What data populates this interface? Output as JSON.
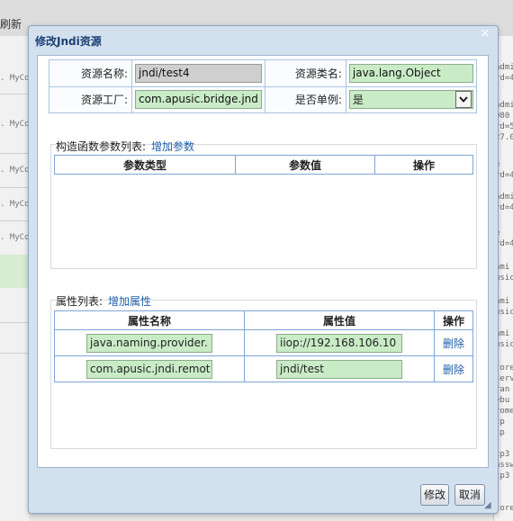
{
  "background": {
    "refresh_label": "刷新",
    "left_rows": [
      ". MyCo",
      ". MyCo",
      ". MyCo",
      ". MyCo",
      ". MyCo"
    ],
    "right_rows": [
      "admi",
      "rd=4",
      "admi",
      "080",
      "rd=5",
      "27.0",
      "e",
      "rd=4",
      "admi",
      "rd=4",
      "e",
      "rd=4",
      "ami",
      "usic",
      "ami",
      "usic",
      "ami",
      "usic",
      "tore",
      "serv",
      "ran",
      "ebu",
      "rome",
      "tp",
      "tp",
      "tp3",
      "assw",
      "tp3",
      "tore"
    ]
  },
  "dialog": {
    "title": "修改Jndi资源",
    "close_icon": "×",
    "fields": {
      "resource_name_label": "资源名称:",
      "resource_name_value": "jndi/test4",
      "resource_class_label": "资源类名:",
      "resource_class_value": "java.lang.Object",
      "resource_factory_label": "资源工厂:",
      "resource_factory_value": "com.apusic.bridge.jnd",
      "singleton_label": "是否单例:",
      "singleton_value": "是"
    },
    "constructor_section": {
      "label": "构造函数参数列表:",
      "add_link": "增加参数",
      "headers": [
        "参数类型",
        "参数值",
        "操作"
      ]
    },
    "property_section": {
      "label": "属性列表:",
      "add_link": "增加属性",
      "headers": [
        "属性名称",
        "属性值",
        "操作"
      ],
      "rows": [
        {
          "name": "java.naming.provider.",
          "value": "iiop://192.168.106.10",
          "action": "删除"
        },
        {
          "name": "com.apusic.jndi.remot",
          "value": "jndi/test",
          "action": "删除"
        }
      ]
    },
    "buttons": {
      "modify": "修改",
      "cancel": "取消"
    }
  }
}
